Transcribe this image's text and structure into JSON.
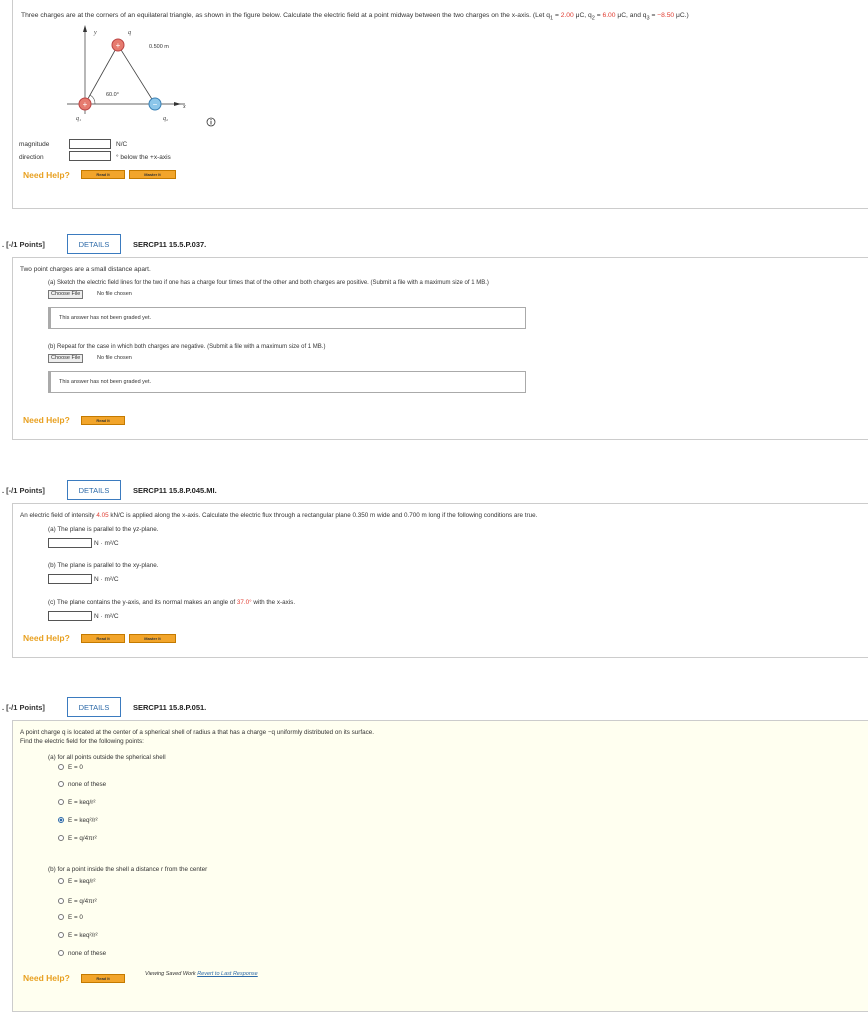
{
  "q1": {
    "text_a": "Three charges are at the corners of an equilateral triangle, as shown in the figure below. Calculate the electric field at a point midway between the two charges on the x-axis. (Let q",
    "text_b": " = ",
    "q1_val": "2.00",
    "text_c": " μC, q",
    "q2_val": "6.00",
    "text_d": " μC, and q",
    "q3_val": "−8.50",
    "text_e": " μC.)",
    "figure": {
      "side": "0.500 m",
      "angle": "60.0°",
      "y": "y",
      "x": "x",
      "q": "q",
      "q1": "q₁",
      "q2": "q₂",
      "plus": "+",
      "minus": "−"
    },
    "magnitude_label": "magnitude",
    "direction_label": "direction",
    "magnitude_unit": "N/C",
    "direction_unit": "° below the +x-axis",
    "info_icon": "info-icon"
  },
  "need_help": "Need Help?",
  "read_it": "Read It",
  "master_it": "Master It",
  "q2": {
    "points": ". [-/1 Points]",
    "details": "DETAILS",
    "code": "SERCP11 15.5.P.037.",
    "intro": "Two point charges are a small distance apart.",
    "part_a": "(a) Sketch the electric field lines for the two if one has a charge four times that of the other and both charges are positive. (Submit a file with a maximum size of 1 MB.)",
    "part_b": "(b) Repeat for the case in which both charges are negative. (Submit a file with a maximum size of 1 MB.)",
    "choose_file": "Choose File",
    "no_file": "No file chosen",
    "not_graded": "This answer has not been graded yet."
  },
  "q3": {
    "points": ". [-/1 Points]",
    "details": "DETAILS",
    "code": "SERCP11 15.8.P.045.MI.",
    "intro_a": "An electric field of intensity ",
    "intensity": "4.05",
    "intro_b": " kN/C is applied along the x-axis. Calculate the electric flux through a rectangular plane 0.350 m wide and 0.700 m long if the following conditions are true.",
    "part_a": "(a) The plane is parallel to the yz-plane.",
    "part_b": "(b) The plane is parallel to the xy-plane.",
    "part_c_a": "(c) The plane contains the y-axis, and its normal makes an angle of ",
    "angle": "37.0°",
    "part_c_b": " with the x-axis.",
    "unit": "N · m²/C"
  },
  "q4": {
    "points": ". [-/1 Points]",
    "details": "DETAILS",
    "code": "SERCP11 15.8.P.051.",
    "intro": "A point charge q is located at the center of a spherical shell of radius a that has a charge −q uniformly distributed on its surface.",
    "find": "Find the electric field for the following points:",
    "part_a": "(a) for all points outside the spherical shell",
    "options_a": [
      "E = 0",
      "none of these",
      "E = keq/r²",
      "E = keq²/r²",
      "E = q/4πr²"
    ],
    "part_b": "(b) for a point inside the shell a distance r from the center",
    "options_b": [
      "E = keq/r²",
      "E = q/4πr²",
      "E = 0",
      "E = keq²/r²",
      "none of these"
    ]
  },
  "footer": {
    "text": "Viewing Saved Work ",
    "link": "Revert to Last Response"
  }
}
